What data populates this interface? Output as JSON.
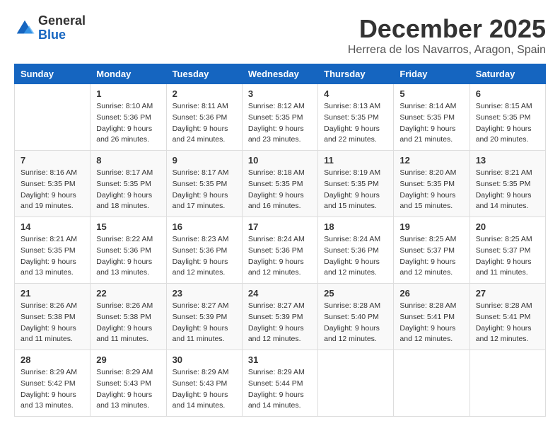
{
  "logo": {
    "general": "General",
    "blue": "Blue"
  },
  "title": "December 2025",
  "location": "Herrera de los Navarros, Aragon, Spain",
  "days_of_week": [
    "Sunday",
    "Monday",
    "Tuesday",
    "Wednesday",
    "Thursday",
    "Friday",
    "Saturday"
  ],
  "weeks": [
    [
      {
        "day": "",
        "info": ""
      },
      {
        "day": "1",
        "info": "Sunrise: 8:10 AM\nSunset: 5:36 PM\nDaylight: 9 hours\nand 26 minutes."
      },
      {
        "day": "2",
        "info": "Sunrise: 8:11 AM\nSunset: 5:36 PM\nDaylight: 9 hours\nand 24 minutes."
      },
      {
        "day": "3",
        "info": "Sunrise: 8:12 AM\nSunset: 5:35 PM\nDaylight: 9 hours\nand 23 minutes."
      },
      {
        "day": "4",
        "info": "Sunrise: 8:13 AM\nSunset: 5:35 PM\nDaylight: 9 hours\nand 22 minutes."
      },
      {
        "day": "5",
        "info": "Sunrise: 8:14 AM\nSunset: 5:35 PM\nDaylight: 9 hours\nand 21 minutes."
      },
      {
        "day": "6",
        "info": "Sunrise: 8:15 AM\nSunset: 5:35 PM\nDaylight: 9 hours\nand 20 minutes."
      }
    ],
    [
      {
        "day": "7",
        "info": "Sunrise: 8:16 AM\nSunset: 5:35 PM\nDaylight: 9 hours\nand 19 minutes."
      },
      {
        "day": "8",
        "info": "Sunrise: 8:17 AM\nSunset: 5:35 PM\nDaylight: 9 hours\nand 18 minutes."
      },
      {
        "day": "9",
        "info": "Sunrise: 8:17 AM\nSunset: 5:35 PM\nDaylight: 9 hours\nand 17 minutes."
      },
      {
        "day": "10",
        "info": "Sunrise: 8:18 AM\nSunset: 5:35 PM\nDaylight: 9 hours\nand 16 minutes."
      },
      {
        "day": "11",
        "info": "Sunrise: 8:19 AM\nSunset: 5:35 PM\nDaylight: 9 hours\nand 15 minutes."
      },
      {
        "day": "12",
        "info": "Sunrise: 8:20 AM\nSunset: 5:35 PM\nDaylight: 9 hours\nand 15 minutes."
      },
      {
        "day": "13",
        "info": "Sunrise: 8:21 AM\nSunset: 5:35 PM\nDaylight: 9 hours\nand 14 minutes."
      }
    ],
    [
      {
        "day": "14",
        "info": "Sunrise: 8:21 AM\nSunset: 5:35 PM\nDaylight: 9 hours\nand 13 minutes."
      },
      {
        "day": "15",
        "info": "Sunrise: 8:22 AM\nSunset: 5:36 PM\nDaylight: 9 hours\nand 13 minutes."
      },
      {
        "day": "16",
        "info": "Sunrise: 8:23 AM\nSunset: 5:36 PM\nDaylight: 9 hours\nand 12 minutes."
      },
      {
        "day": "17",
        "info": "Sunrise: 8:24 AM\nSunset: 5:36 PM\nDaylight: 9 hours\nand 12 minutes."
      },
      {
        "day": "18",
        "info": "Sunrise: 8:24 AM\nSunset: 5:36 PM\nDaylight: 9 hours\nand 12 minutes."
      },
      {
        "day": "19",
        "info": "Sunrise: 8:25 AM\nSunset: 5:37 PM\nDaylight: 9 hours\nand 12 minutes."
      },
      {
        "day": "20",
        "info": "Sunrise: 8:25 AM\nSunset: 5:37 PM\nDaylight: 9 hours\nand 11 minutes."
      }
    ],
    [
      {
        "day": "21",
        "info": "Sunrise: 8:26 AM\nSunset: 5:38 PM\nDaylight: 9 hours\nand 11 minutes."
      },
      {
        "day": "22",
        "info": "Sunrise: 8:26 AM\nSunset: 5:38 PM\nDaylight: 9 hours\nand 11 minutes."
      },
      {
        "day": "23",
        "info": "Sunrise: 8:27 AM\nSunset: 5:39 PM\nDaylight: 9 hours\nand 11 minutes."
      },
      {
        "day": "24",
        "info": "Sunrise: 8:27 AM\nSunset: 5:39 PM\nDaylight: 9 hours\nand 12 minutes."
      },
      {
        "day": "25",
        "info": "Sunrise: 8:28 AM\nSunset: 5:40 PM\nDaylight: 9 hours\nand 12 minutes."
      },
      {
        "day": "26",
        "info": "Sunrise: 8:28 AM\nSunset: 5:41 PM\nDaylight: 9 hours\nand 12 minutes."
      },
      {
        "day": "27",
        "info": "Sunrise: 8:28 AM\nSunset: 5:41 PM\nDaylight: 9 hours\nand 12 minutes."
      }
    ],
    [
      {
        "day": "28",
        "info": "Sunrise: 8:29 AM\nSunset: 5:42 PM\nDaylight: 9 hours\nand 13 minutes."
      },
      {
        "day": "29",
        "info": "Sunrise: 8:29 AM\nSunset: 5:43 PM\nDaylight: 9 hours\nand 13 minutes."
      },
      {
        "day": "30",
        "info": "Sunrise: 8:29 AM\nSunset: 5:43 PM\nDaylight: 9 hours\nand 14 minutes."
      },
      {
        "day": "31",
        "info": "Sunrise: 8:29 AM\nSunset: 5:44 PM\nDaylight: 9 hours\nand 14 minutes."
      },
      {
        "day": "",
        "info": ""
      },
      {
        "day": "",
        "info": ""
      },
      {
        "day": "",
        "info": ""
      }
    ]
  ]
}
